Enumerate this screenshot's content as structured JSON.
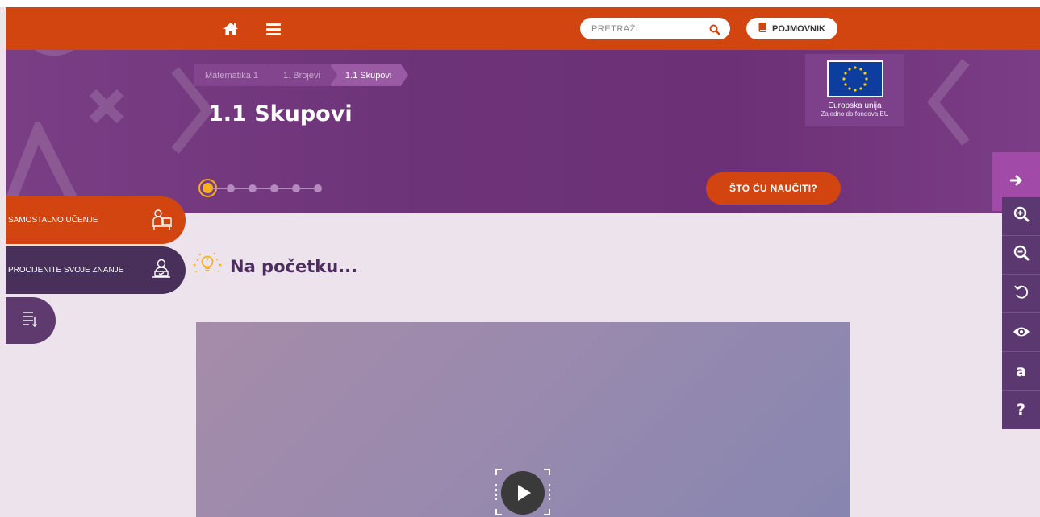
{
  "navbar": {
    "search_placeholder": "PRETRAŽI",
    "glossary_label": "POJMOVNIK",
    "bg_color": "#d24510"
  },
  "hero": {
    "breadcrumbs": [
      "Matematika 1",
      "1. Brojevi",
      "1.1 Skupovi"
    ],
    "title": "1.1 Skupovi",
    "eu_line1": "Europska unija",
    "eu_line2": "Zajedno do fondova EU",
    "learn_button": "ŠTO ĆU NAUČITI?",
    "step_count": 6,
    "current_step": 1
  },
  "sidebar": {
    "self_study": "SAMOSTALNO UČENJE",
    "assess": "PROCIJENITE SVOJE ZNANJE"
  },
  "main": {
    "section_title": "Na početku..."
  },
  "tools": [
    {
      "name": "zoom-in-icon"
    },
    {
      "name": "zoom-out-icon"
    },
    {
      "name": "reset-icon"
    },
    {
      "name": "eye-icon"
    },
    {
      "name": "font-icon",
      "label": "a"
    },
    {
      "name": "help-icon",
      "label": "?"
    }
  ]
}
